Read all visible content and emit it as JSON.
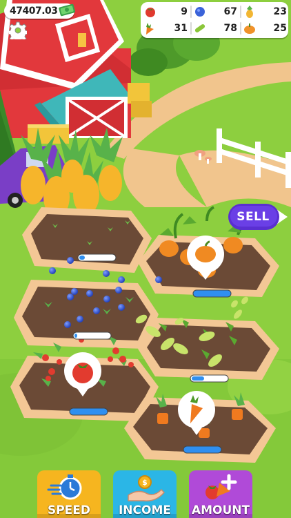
{
  "hud": {
    "money": "47407.03"
  },
  "inventory": [
    {
      "crop": "tomato",
      "count": "9",
      "color": "#e03a2f"
    },
    {
      "crop": "blueberry",
      "count": "67",
      "color": "#3b63d9"
    },
    {
      "crop": "pineapple",
      "count": "23",
      "color": "#f2b633"
    },
    {
      "crop": "carrot",
      "count": "31",
      "color": "#f07a1f"
    },
    {
      "crop": "cucumber",
      "count": "78",
      "color": "#8bc63a"
    },
    {
      "crop": "pumpkin",
      "count": "25",
      "color": "#f0922a"
    }
  ],
  "actions": {
    "sell": "SELL",
    "speed": "SPEED",
    "income": "INCOME",
    "amount": "AMOUNT"
  },
  "colors": {
    "grass": "#8dcf3f",
    "path": "#f1c58d",
    "soil": "#6b4a36",
    "sell": "#5a2fd1",
    "speed": "#f6b51f",
    "income": "#2bb6e6",
    "amount": "#b04ad8"
  }
}
